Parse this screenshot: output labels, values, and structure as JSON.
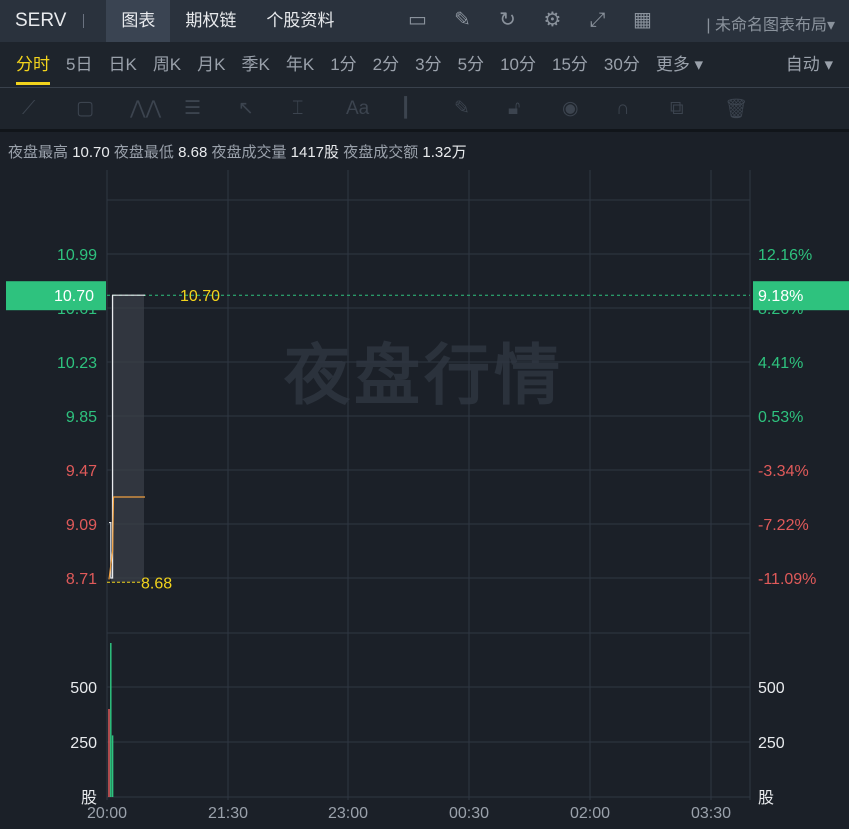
{
  "topbar": {
    "symbol": "SERV",
    "tabs": [
      "图表",
      "期权链",
      "个股资料"
    ],
    "active_tab": 0,
    "icons": [
      "indicator-icon",
      "draw-icon",
      "refresh-icon",
      "settings-icon",
      "fullscreen-icon",
      "layout-grid-icon"
    ],
    "layout_name": "未命名图表布局"
  },
  "periods": {
    "items": [
      "分时",
      "5日",
      "日K",
      "周K",
      "月K",
      "季K",
      "年K",
      "1分",
      "2分",
      "3分",
      "5分",
      "10分",
      "15分",
      "30分",
      "更多 ▾"
    ],
    "active": 0,
    "mode": "自动 ▾"
  },
  "tools": [
    "line-tool-icon",
    "rect-tool-icon",
    "pattern-tool-icon",
    "fib-tool-icon",
    "arrow-tool-icon",
    "measure-tool-icon",
    "text-tool-icon",
    "candle-tool-icon",
    "pen-icon",
    "lock-icon",
    "eye-icon",
    "magnet-icon",
    "clone-icon",
    "trash-icon"
  ],
  "info": {
    "high_label": "夜盘最高",
    "high": "10.70",
    "low_label": "夜盘最低",
    "low": "8.68",
    "vol_label": "夜盘成交量",
    "vol": "1417股",
    "amt_label": "夜盘成交额",
    "amt": "1.32万"
  },
  "watermark": "夜盘行情",
  "colors": {
    "up": "#2ec27e",
    "down": "#e05a5a",
    "accent": "#f2d31c",
    "avg": "#f0a040"
  },
  "chart_data": {
    "type": "line",
    "price_ticks": [
      "10.99",
      "10.61",
      "10.23",
      "9.85",
      "9.47",
      "9.09",
      "8.71"
    ],
    "pct_ticks": [
      "12.16%",
      "8.26%",
      "4.41%",
      "0.53%",
      "-3.34%",
      "-7.22%",
      "-11.09%"
    ],
    "current_price": "10.70",
    "current_pct": "9.18%",
    "high_mark": "10.70",
    "low_mark": "8.68",
    "x_ticks": [
      "20:00",
      "21:30",
      "23:00",
      "00:30",
      "02:00",
      "03:30"
    ],
    "price": [
      [
        0,
        9.1
      ],
      [
        1,
        9.1
      ],
      [
        1,
        8.71
      ],
      [
        2,
        8.71
      ],
      [
        2,
        10.7
      ],
      [
        20,
        10.7
      ]
    ],
    "avg": [
      [
        0,
        8.7
      ],
      [
        1,
        8.8
      ],
      [
        2,
        8.9
      ],
      [
        2.5,
        9.28
      ],
      [
        20,
        9.28
      ]
    ],
    "vol_ticks": [
      "500",
      "250",
      "股"
    ],
    "volume": [
      [
        0,
        400
      ],
      [
        1,
        700
      ],
      [
        2,
        280
      ]
    ]
  }
}
